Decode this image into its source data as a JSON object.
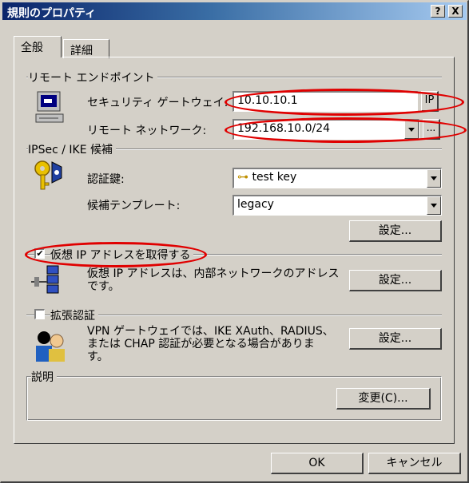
{
  "window": {
    "title": "規則のプロパティ",
    "help_btn": "?",
    "close_btn": "X"
  },
  "tabs": [
    "全般",
    "詳細"
  ],
  "remote_endpoint": {
    "group_label": "リモート エンドポイント",
    "gateway_label": "セキュリティ ゲートウェイ:",
    "gateway_value": "10.10.10.1",
    "gateway_btn": "IP",
    "network_label": "リモート ネットワーク:",
    "network_value": "192.168.10.0/24",
    "network_btn": "..."
  },
  "ipsec": {
    "group_label": "IPSec / IKE 候補",
    "auth_label": "認証鍵:",
    "auth_value": "test key",
    "template_label": "候補テンプレート:",
    "template_value": "legacy",
    "settings_btn": "設定..."
  },
  "virtual_ip": {
    "checkbox_label": "仮想 IP アドレスを取得する",
    "checked": true,
    "checkmark": "✔",
    "description": "仮想 IP アドレスは、内部ネットワークのアドレスです。",
    "settings_btn": "設定..."
  },
  "ext_auth": {
    "checkbox_label": "拡張認証",
    "checked": false,
    "description": "VPN ゲートウェイでは、IKE XAuth、RADIUS、または CHAP 認証が必要となる場合があります。",
    "settings_btn": "設定..."
  },
  "description_group": {
    "label": "説明",
    "change_btn": "変更(C)..."
  },
  "footer": {
    "ok_btn": "OK",
    "cancel_btn": "キャンセル"
  },
  "colors": {
    "highlight": "#e00000",
    "title_bar": "#0a246a",
    "dialog_bg": "#d4d0c8"
  }
}
